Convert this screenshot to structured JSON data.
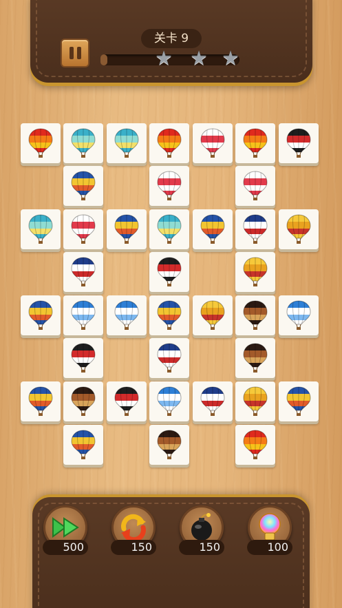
{
  "level": {
    "label": "关卡 9"
  },
  "progress": {
    "fraction": 0.05,
    "stars_total": 3,
    "stars_earned": 0
  },
  "balloon_styles": {
    "red_orange": [
      "#e02a1e",
      "#f57b16",
      "#f7c21a",
      "#e02a1e"
    ],
    "teal": [
      "#3ab0c9",
      "#8fdcd2",
      "#f2e06a",
      "#3ab0c9"
    ],
    "hearts": [
      "#ffffff",
      "#e23a4b",
      "#ffffff",
      "#e23a4b"
    ],
    "black_red": [
      "#1e1e1e",
      "#d32b2b",
      "#ffffff",
      "#1e1e1e"
    ],
    "blue_yellow": [
      "#2453a8",
      "#f2c531",
      "#e25b2a",
      "#2453a8"
    ],
    "usa": [
      "#1f3d8a",
      "#ffffff",
      "#cc2a2a",
      "#ffffff"
    ],
    "yellow": [
      "#f6c93a",
      "#e9a21f",
      "#c7342a",
      "#f6c93a"
    ],
    "blue_white": [
      "#2e7fd6",
      "#ffffff",
      "#7db8f0",
      "#ffffff"
    ],
    "brown": [
      "#2b1a12",
      "#a35a2a",
      "#d9a45a",
      "#2b1a12"
    ]
  },
  "board": {
    "tiles": [
      "red_orange",
      "teal",
      "teal",
      "red_orange",
      "hearts",
      "red_orange",
      "black_red",
      "blue_yellow",
      "hearts",
      "hearts",
      "teal",
      "hearts",
      "blue_yellow",
      "teal",
      "blue_yellow",
      "usa",
      "yellow",
      "usa",
      "black_red",
      "yellow",
      "blue_yellow",
      "blue_white",
      "blue_white",
      "blue_yellow",
      "yellow",
      "brown",
      "blue_white",
      "black_red",
      "usa",
      "brown",
      "blue_yellow",
      "brown",
      "black_red",
      "blue_white",
      "usa",
      "yellow",
      "blue_yellow",
      "blue_yellow",
      "brown",
      "red_orange"
    ]
  },
  "tools": [
    {
      "name": "shuffle-forward",
      "price": "500",
      "icon": "green-play-arrows-icon"
    },
    {
      "name": "undo",
      "price": "150",
      "icon": "refresh-arrows-icon"
    },
    {
      "name": "bomb",
      "price": "150",
      "icon": "bomb-icon"
    },
    {
      "name": "hint",
      "price": "100",
      "icon": "lightbulb-icon"
    }
  ],
  "colors": {
    "panel": "#4a2e1c",
    "gold_trim": "#c9952f",
    "tile": "#fbf8f1"
  }
}
